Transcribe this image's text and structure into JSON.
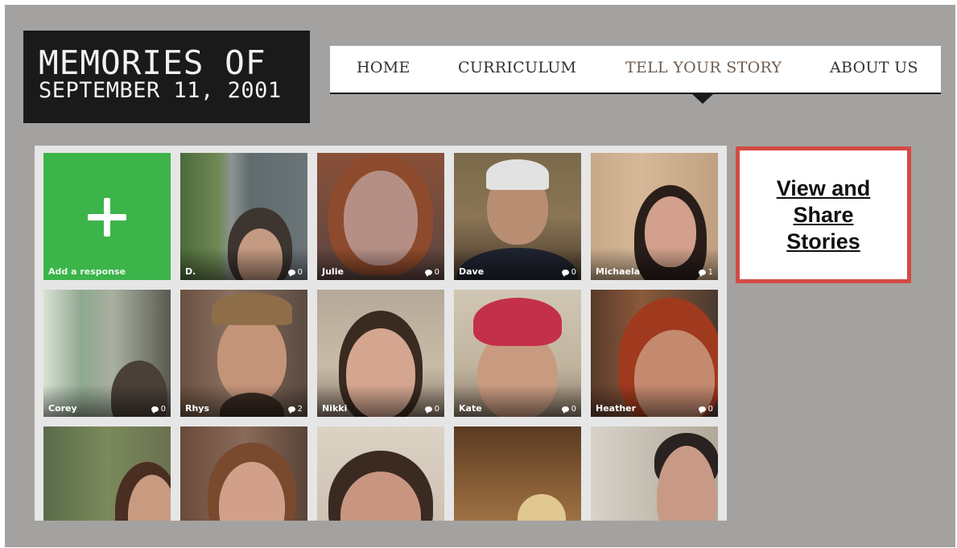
{
  "logo": {
    "line1": "MEMORIES OF",
    "line2": "SEPTEMBER 11, 2001"
  },
  "nav": {
    "items": [
      {
        "label": "HOME"
      },
      {
        "label": "CURRICULUM"
      },
      {
        "label": "TELL YOUR STORY",
        "active": true
      },
      {
        "label": "ABOUT US"
      }
    ]
  },
  "grid": {
    "add_tile": {
      "label": "Add a response",
      "color": "#3cb44a"
    },
    "tiles": [
      {
        "name": "D.",
        "count": "0"
      },
      {
        "name": "Julie",
        "count": "0"
      },
      {
        "name": "Dave",
        "count": "0"
      },
      {
        "name": "Michaela",
        "count": "1"
      },
      {
        "name": "Corey",
        "count": "0"
      },
      {
        "name": "Rhys",
        "count": "2"
      },
      {
        "name": "Nikki",
        "count": "0"
      },
      {
        "name": "Kate",
        "count": "0"
      },
      {
        "name": "Heather",
        "count": "0"
      },
      {
        "name": "",
        "count": ""
      },
      {
        "name": "",
        "count": ""
      },
      {
        "name": "",
        "count": ""
      },
      {
        "name": "",
        "count": ""
      },
      {
        "name": "",
        "count": ""
      }
    ]
  },
  "callout": {
    "link_text": "View and Share Stories",
    "border_color": "#d44a44"
  }
}
